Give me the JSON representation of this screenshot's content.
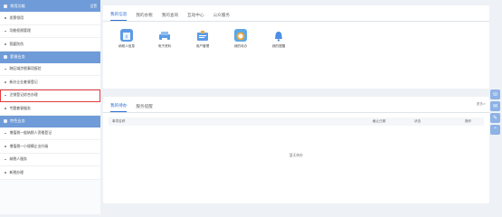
{
  "sidebar": {
    "section1": {
      "title": "常用功能",
      "more": "设置",
      "items": [
        "发票领用",
        "功能权限管理",
        "我要防伪"
      ]
    },
    "section2": {
      "title": "套餐业务",
      "items": [
        "跨区域涉税事项报验",
        "新办企业套餐登记",
        "注销登记综合办理",
        "专题套餐服务"
      ]
    },
    "section3": {
      "title": "特色业务",
      "items": [
        "增值税一般纳税人资格登记",
        "增值税一小规模企业升级",
        "纳税人服务",
        "新税办理"
      ]
    }
  },
  "top_tabs": [
    "我的信息",
    "我的办税",
    "我的查询",
    "互动中心",
    "公众服务"
  ],
  "shortcuts": [
    {
      "label": "纳税人信息",
      "icon": "taxpayer-info-icon",
      "color": "#5b9be6"
    },
    {
      "label": "电子资料",
      "icon": "electronic-data-icon",
      "color": "#5b9be6"
    },
    {
      "label": "用户管理",
      "icon": "user-management-icon",
      "color": "#5b9be6"
    },
    {
      "label": "我的待办",
      "icon": "todo-icon",
      "color": "#f0a638"
    },
    {
      "label": "我的提醒",
      "icon": "reminder-icon",
      "color": "#4c8ee3"
    }
  ],
  "bottom_tabs": [
    "我的待办",
    "服务提醒"
  ],
  "more_link": "更多>",
  "table_headers": [
    "事项名称",
    "截止日期",
    "状态",
    "操作"
  ],
  "empty_text": "暂无待办",
  "accent": "#2f6fd3"
}
